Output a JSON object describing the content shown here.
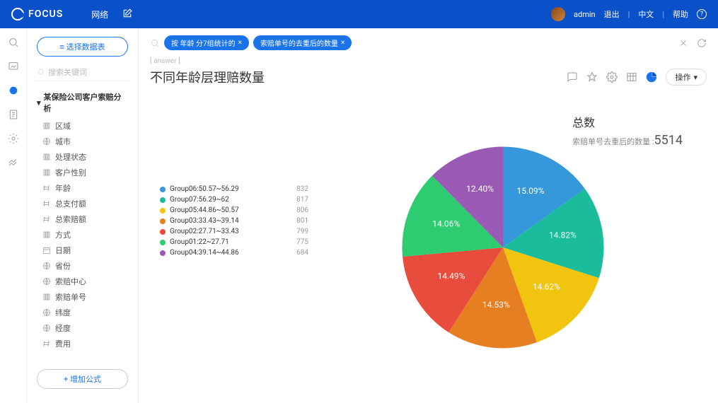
{
  "header": {
    "logo": "FOCUS",
    "nav1": "网络",
    "user": "admin",
    "logout": "退出",
    "lang": "中文",
    "help": "帮助"
  },
  "sidebar": {
    "select_btn": "≡ 选择数据表",
    "search_ph": "搜索关键词",
    "tree_header": "某保险公司客户索赔分析",
    "items": [
      {
        "icon": "col",
        "label": "区域"
      },
      {
        "icon": "globe",
        "label": "城市"
      },
      {
        "icon": "col",
        "label": "处理状态"
      },
      {
        "icon": "col",
        "label": "客户性别"
      },
      {
        "icon": "num",
        "label": "年龄"
      },
      {
        "icon": "num",
        "label": "总支付额"
      },
      {
        "icon": "num",
        "label": "总索赔额"
      },
      {
        "icon": "col",
        "label": "方式"
      },
      {
        "icon": "cal",
        "label": "日期"
      },
      {
        "icon": "globe",
        "label": "省份"
      },
      {
        "icon": "globe",
        "label": "索赔中心"
      },
      {
        "icon": "col",
        "label": "索赔单号"
      },
      {
        "icon": "globe",
        "label": "纬度"
      },
      {
        "icon": "globe",
        "label": "经度"
      },
      {
        "icon": "num",
        "label": "费用"
      }
    ],
    "add_formula": "+ 增加公式"
  },
  "query": {
    "pill1": "按 年龄 分7组统计的",
    "pill2": "索赔单号的去重后的数量"
  },
  "breadcrumb": "[ answer ]",
  "title": "不同年龄层理赔数量",
  "toolbar": {
    "op_btn": "操作"
  },
  "summary": {
    "title": "总数",
    "label": "索赔单号去重后的数量 :",
    "value": "5514"
  },
  "chart_data": {
    "type": "pie",
    "title": "不同年龄层理赔数量",
    "series": [
      {
        "name": "Group06:50.57~56.29",
        "value": 832,
        "pct": 15.09,
        "color": "#3498db"
      },
      {
        "name": "Group07:56.29~62",
        "value": 817,
        "pct": 14.82,
        "color": "#1abc9c"
      },
      {
        "name": "Group05:44.86~50.57",
        "value": 806,
        "pct": 14.62,
        "color": "#f1c40f"
      },
      {
        "name": "Group03:33.43~39.14",
        "value": 801,
        "pct": 14.53,
        "color": "#e67e22"
      },
      {
        "name": "Group02:27.71~33.43",
        "value": 799,
        "pct": 14.49,
        "color": "#e74c3c"
      },
      {
        "name": "Group01:22~27.71",
        "value": 775,
        "pct": 14.06,
        "color": "#2ecc71"
      },
      {
        "name": "Group04:39.14~44.86",
        "value": 684,
        "pct": 12.4,
        "color": "#9b59b6"
      }
    ],
    "total": 5514
  }
}
